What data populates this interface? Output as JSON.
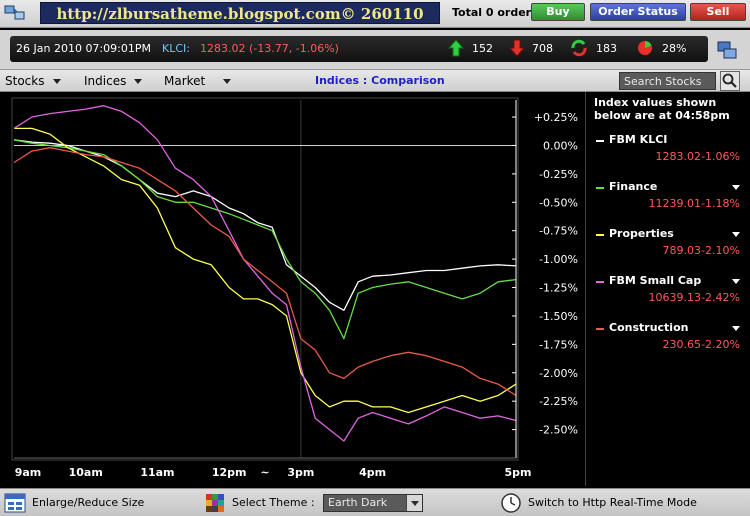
{
  "titlebar": {
    "banner": "http://zlbursatheme.blogspot.com©   260110",
    "order_total": "Total 0 order",
    "buy_label": "Buy",
    "order_status_label": "Order Status",
    "sell_label": "Sell",
    "colors": {
      "buy": "#3aa33a",
      "order_status": "#3a52c4",
      "sell": "#d43a2f"
    }
  },
  "stats": {
    "datetime": "26 Jan 2010 07:09:01PM",
    "klci_label": "KLCI:",
    "klci_value": "1283.02 (-13.77, -1.06%)",
    "up_count": "152",
    "down_count": "708",
    "unchanged_count": "183",
    "percent": "28%",
    "icons": [
      "up-arrow-icon",
      "down-arrow-icon",
      "unchanged-icon",
      "pie-icon",
      "settings-icon"
    ]
  },
  "menu": {
    "stocks": "Stocks",
    "indices": "Indices",
    "market": "Market",
    "title": "Indices : Comparison",
    "search_placeholder": "Search Stocks"
  },
  "legend": {
    "header": "Index values shown below are at 04:58pm",
    "entries": [
      {
        "name": "FBM KLCI",
        "value": "1283.02",
        "change": "-1.06%",
        "color": "#ffffff",
        "dropdown": false
      },
      {
        "name": "Finance",
        "value": "11239.01",
        "change": "-1.18%",
        "color": "#66dd44",
        "dropdown": true
      },
      {
        "name": "Properties",
        "value": "789.03",
        "change": "-2.10%",
        "color": "#ffff55",
        "dropdown": true
      },
      {
        "name": "FBM Small Cap",
        "value": "10639.13",
        "change": "-2.42%",
        "color": "#e066e0",
        "dropdown": true
      },
      {
        "name": "Construction",
        "value": "230.65",
        "change": "-2.20%",
        "color": "#e85a4a",
        "dropdown": true
      }
    ]
  },
  "chart_data": {
    "type": "line",
    "title": "",
    "xlabel": "",
    "ylabel": "",
    "x_ticks": [
      "9am",
      "10am",
      "11am",
      "12pm",
      "~",
      "3pm",
      "4pm",
      "5pm"
    ],
    "y_ticks": [
      "+0.25%",
      "0.00%",
      "-0.25%",
      "-0.50%",
      "-0.75%",
      "-1.00%",
      "-1.25%",
      "-1.50%",
      "-1.75%",
      "-2.00%",
      "-2.25%",
      "-2.50%"
    ],
    "ylim": [
      -2.75,
      0.4
    ],
    "x_range": [
      0,
      7
    ],
    "grid": false,
    "series": [
      {
        "name": "FBM KLCI",
        "color": "#ffffff",
        "x": [
          0,
          0.25,
          0.5,
          0.75,
          1.0,
          1.25,
          1.5,
          1.75,
          2.0,
          2.25,
          2.5,
          2.75,
          3.0,
          3.2,
          3.4,
          3.6,
          3.8,
          4.0,
          4.2,
          4.4,
          4.6,
          4.8,
          5.0,
          5.25,
          5.5,
          5.75,
          6.0,
          6.25,
          6.5,
          6.75,
          7.0
        ],
        "y": [
          0.05,
          0.03,
          0.02,
          0.0,
          -0.05,
          -0.1,
          -0.18,
          -0.3,
          -0.42,
          -0.45,
          -0.4,
          -0.45,
          -0.55,
          -0.6,
          -0.68,
          -0.72,
          -1.05,
          -1.15,
          -1.25,
          -1.38,
          -1.45,
          -1.2,
          -1.15,
          -1.14,
          -1.12,
          -1.1,
          -1.1,
          -1.08,
          -1.06,
          -1.05,
          -1.06
        ]
      },
      {
        "name": "Finance",
        "color": "#66dd44",
        "x": [
          0,
          0.25,
          0.5,
          0.75,
          1.0,
          1.25,
          1.5,
          1.75,
          2.0,
          2.25,
          2.5,
          2.75,
          3.0,
          3.2,
          3.4,
          3.6,
          3.8,
          4.0,
          4.2,
          4.4,
          4.6,
          4.8,
          5.0,
          5.25,
          5.5,
          5.75,
          6.0,
          6.25,
          6.5,
          6.75,
          7.0
        ],
        "y": [
          0.05,
          0.02,
          0.0,
          -0.02,
          -0.05,
          -0.08,
          -0.18,
          -0.3,
          -0.45,
          -0.5,
          -0.5,
          -0.55,
          -0.6,
          -0.65,
          -0.7,
          -0.75,
          -1.0,
          -1.2,
          -1.3,
          -1.45,
          -1.7,
          -1.3,
          -1.25,
          -1.22,
          -1.2,
          -1.25,
          -1.3,
          -1.35,
          -1.3,
          -1.2,
          -1.18
        ]
      },
      {
        "name": "Properties",
        "color": "#ffff55",
        "x": [
          0,
          0.25,
          0.5,
          0.75,
          1.0,
          1.25,
          1.5,
          1.75,
          2.0,
          2.25,
          2.5,
          2.75,
          3.0,
          3.2,
          3.4,
          3.6,
          3.8,
          4.0,
          4.2,
          4.4,
          4.6,
          4.8,
          5.0,
          5.25,
          5.5,
          5.75,
          6.0,
          6.25,
          6.5,
          6.75,
          7.0
        ],
        "y": [
          0.15,
          0.15,
          0.1,
          -0.02,
          -0.1,
          -0.18,
          -0.3,
          -0.35,
          -0.55,
          -0.9,
          -1.0,
          -1.05,
          -1.25,
          -1.35,
          -1.35,
          -1.4,
          -1.5,
          -2.0,
          -2.2,
          -2.3,
          -2.25,
          -2.25,
          -2.3,
          -2.3,
          -2.35,
          -2.3,
          -2.25,
          -2.2,
          -2.25,
          -2.2,
          -2.1
        ]
      },
      {
        "name": "FBM Small Cap",
        "color": "#e066e0",
        "x": [
          0,
          0.25,
          0.5,
          0.75,
          1.0,
          1.25,
          1.5,
          1.75,
          2.0,
          2.25,
          2.5,
          2.75,
          3.0,
          3.2,
          3.4,
          3.6,
          3.8,
          4.0,
          4.2,
          4.4,
          4.6,
          4.8,
          5.0,
          5.25,
          5.5,
          5.75,
          6.0,
          6.25,
          6.5,
          6.75,
          7.0
        ],
        "y": [
          0.15,
          0.25,
          0.28,
          0.3,
          0.32,
          0.35,
          0.3,
          0.2,
          0.05,
          -0.2,
          -0.3,
          -0.45,
          -0.75,
          -1.0,
          -1.15,
          -1.3,
          -1.4,
          -1.95,
          -2.4,
          -2.5,
          -2.6,
          -2.4,
          -2.35,
          -2.4,
          -2.45,
          -2.38,
          -2.3,
          -2.35,
          -2.4,
          -2.38,
          -2.42
        ]
      },
      {
        "name": "Construction",
        "color": "#e85a4a",
        "x": [
          0,
          0.25,
          0.5,
          0.75,
          1.0,
          1.25,
          1.5,
          1.75,
          2.0,
          2.25,
          2.5,
          2.75,
          3.0,
          3.2,
          3.4,
          3.6,
          3.8,
          4.0,
          4.2,
          4.4,
          4.6,
          4.8,
          5.0,
          5.25,
          5.5,
          5.75,
          6.0,
          6.25,
          6.5,
          6.75,
          7.0
        ],
        "y": [
          -0.15,
          -0.05,
          -0.02,
          -0.05,
          -0.08,
          -0.1,
          -0.15,
          -0.2,
          -0.3,
          -0.4,
          -0.55,
          -0.7,
          -0.8,
          -1.0,
          -1.1,
          -1.2,
          -1.3,
          -1.7,
          -1.8,
          -2.0,
          -2.05,
          -1.95,
          -1.9,
          -1.85,
          -1.82,
          -1.85,
          -1.9,
          -1.95,
          -2.05,
          -2.1,
          -2.2
        ]
      }
    ]
  },
  "bottombar": {
    "enlarge_label": "Enlarge/Reduce Size",
    "theme_label": "Select Theme :",
    "theme_value": "Earth Dark",
    "realtime_label": "Switch to Http Real-Time Mode"
  }
}
